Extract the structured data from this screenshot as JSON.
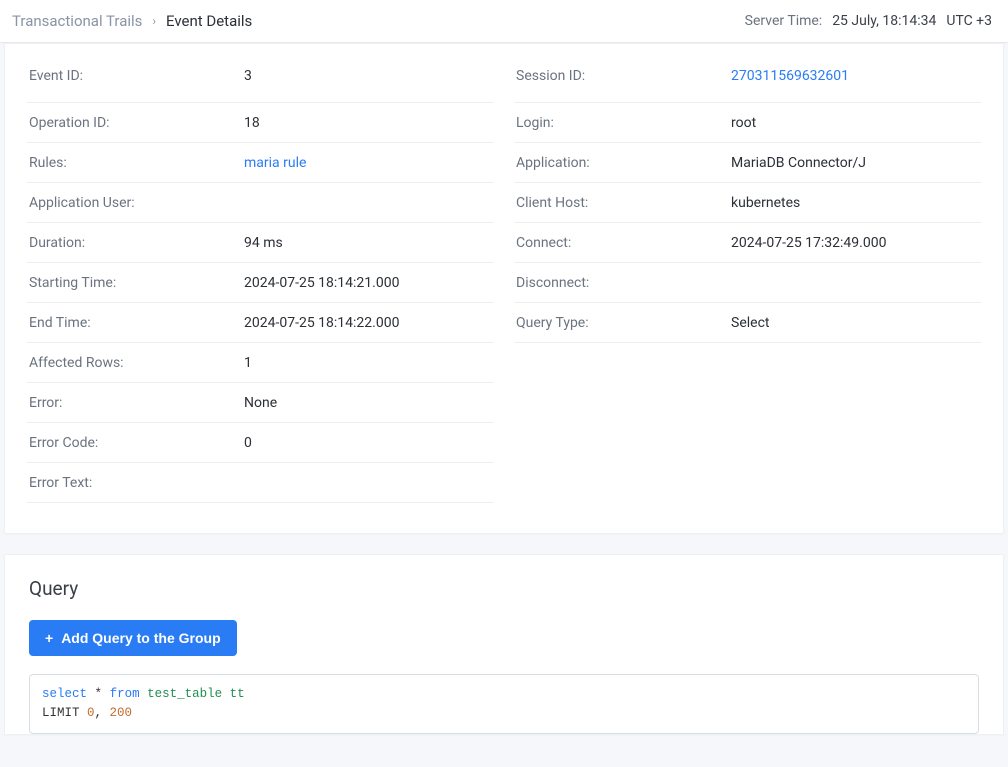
{
  "breadcrumb": {
    "parent": "Transactional Trails",
    "current": "Event Details"
  },
  "server_time": {
    "label": "Server Time:",
    "value": "25 July, 18:14:34",
    "tz": "UTC +3"
  },
  "details": {
    "left": [
      {
        "label": "Event ID:",
        "value": "3",
        "link": false
      },
      {
        "label": "Operation ID:",
        "value": "18",
        "link": false
      },
      {
        "label": "Rules:",
        "value": "maria rule",
        "link": true
      },
      {
        "label": "Application User:",
        "value": "",
        "link": false
      },
      {
        "label": "Duration:",
        "value": "94 ms",
        "link": false
      },
      {
        "label": "Starting Time:",
        "value": "2024-07-25 18:14:21.000",
        "link": false
      },
      {
        "label": "End Time:",
        "value": "2024-07-25 18:14:22.000",
        "link": false
      },
      {
        "label": "Affected Rows:",
        "value": "1",
        "link": false
      },
      {
        "label": "Error:",
        "value": "None",
        "link": false
      },
      {
        "label": "Error Code:",
        "value": "0",
        "link": false
      },
      {
        "label": "Error Text:",
        "value": "",
        "link": false
      }
    ],
    "right": [
      {
        "label": "Session ID:",
        "value": "270311569632601",
        "link": true
      },
      {
        "label": "Login:",
        "value": "root",
        "link": false
      },
      {
        "label": "Application:",
        "value": "MariaDB Connector/J",
        "link": false
      },
      {
        "label": "Client Host:",
        "value": "kubernetes",
        "link": false
      },
      {
        "label": "Connect:",
        "value": "2024-07-25 17:32:49.000",
        "link": false
      },
      {
        "label": "Disconnect:",
        "value": "",
        "link": false
      },
      {
        "label": "Query Type:",
        "value": "Select",
        "link": false
      }
    ]
  },
  "query": {
    "title": "Query",
    "add_button": "Add Query to the Group",
    "sql": {
      "tokens": [
        {
          "t": "kw",
          "v": "select"
        },
        {
          "t": "txt",
          "v": " "
        },
        {
          "t": "star",
          "v": "*"
        },
        {
          "t": "txt",
          "v": " "
        },
        {
          "t": "fromkw",
          "v": "from"
        },
        {
          "t": "txt",
          "v": " "
        },
        {
          "t": "ident",
          "v": "test_table tt"
        },
        {
          "t": "br"
        },
        {
          "t": "txt",
          "v": "LIMIT "
        },
        {
          "t": "num",
          "v": "0"
        },
        {
          "t": "txt",
          "v": ", "
        },
        {
          "t": "num",
          "v": "200"
        }
      ]
    }
  }
}
